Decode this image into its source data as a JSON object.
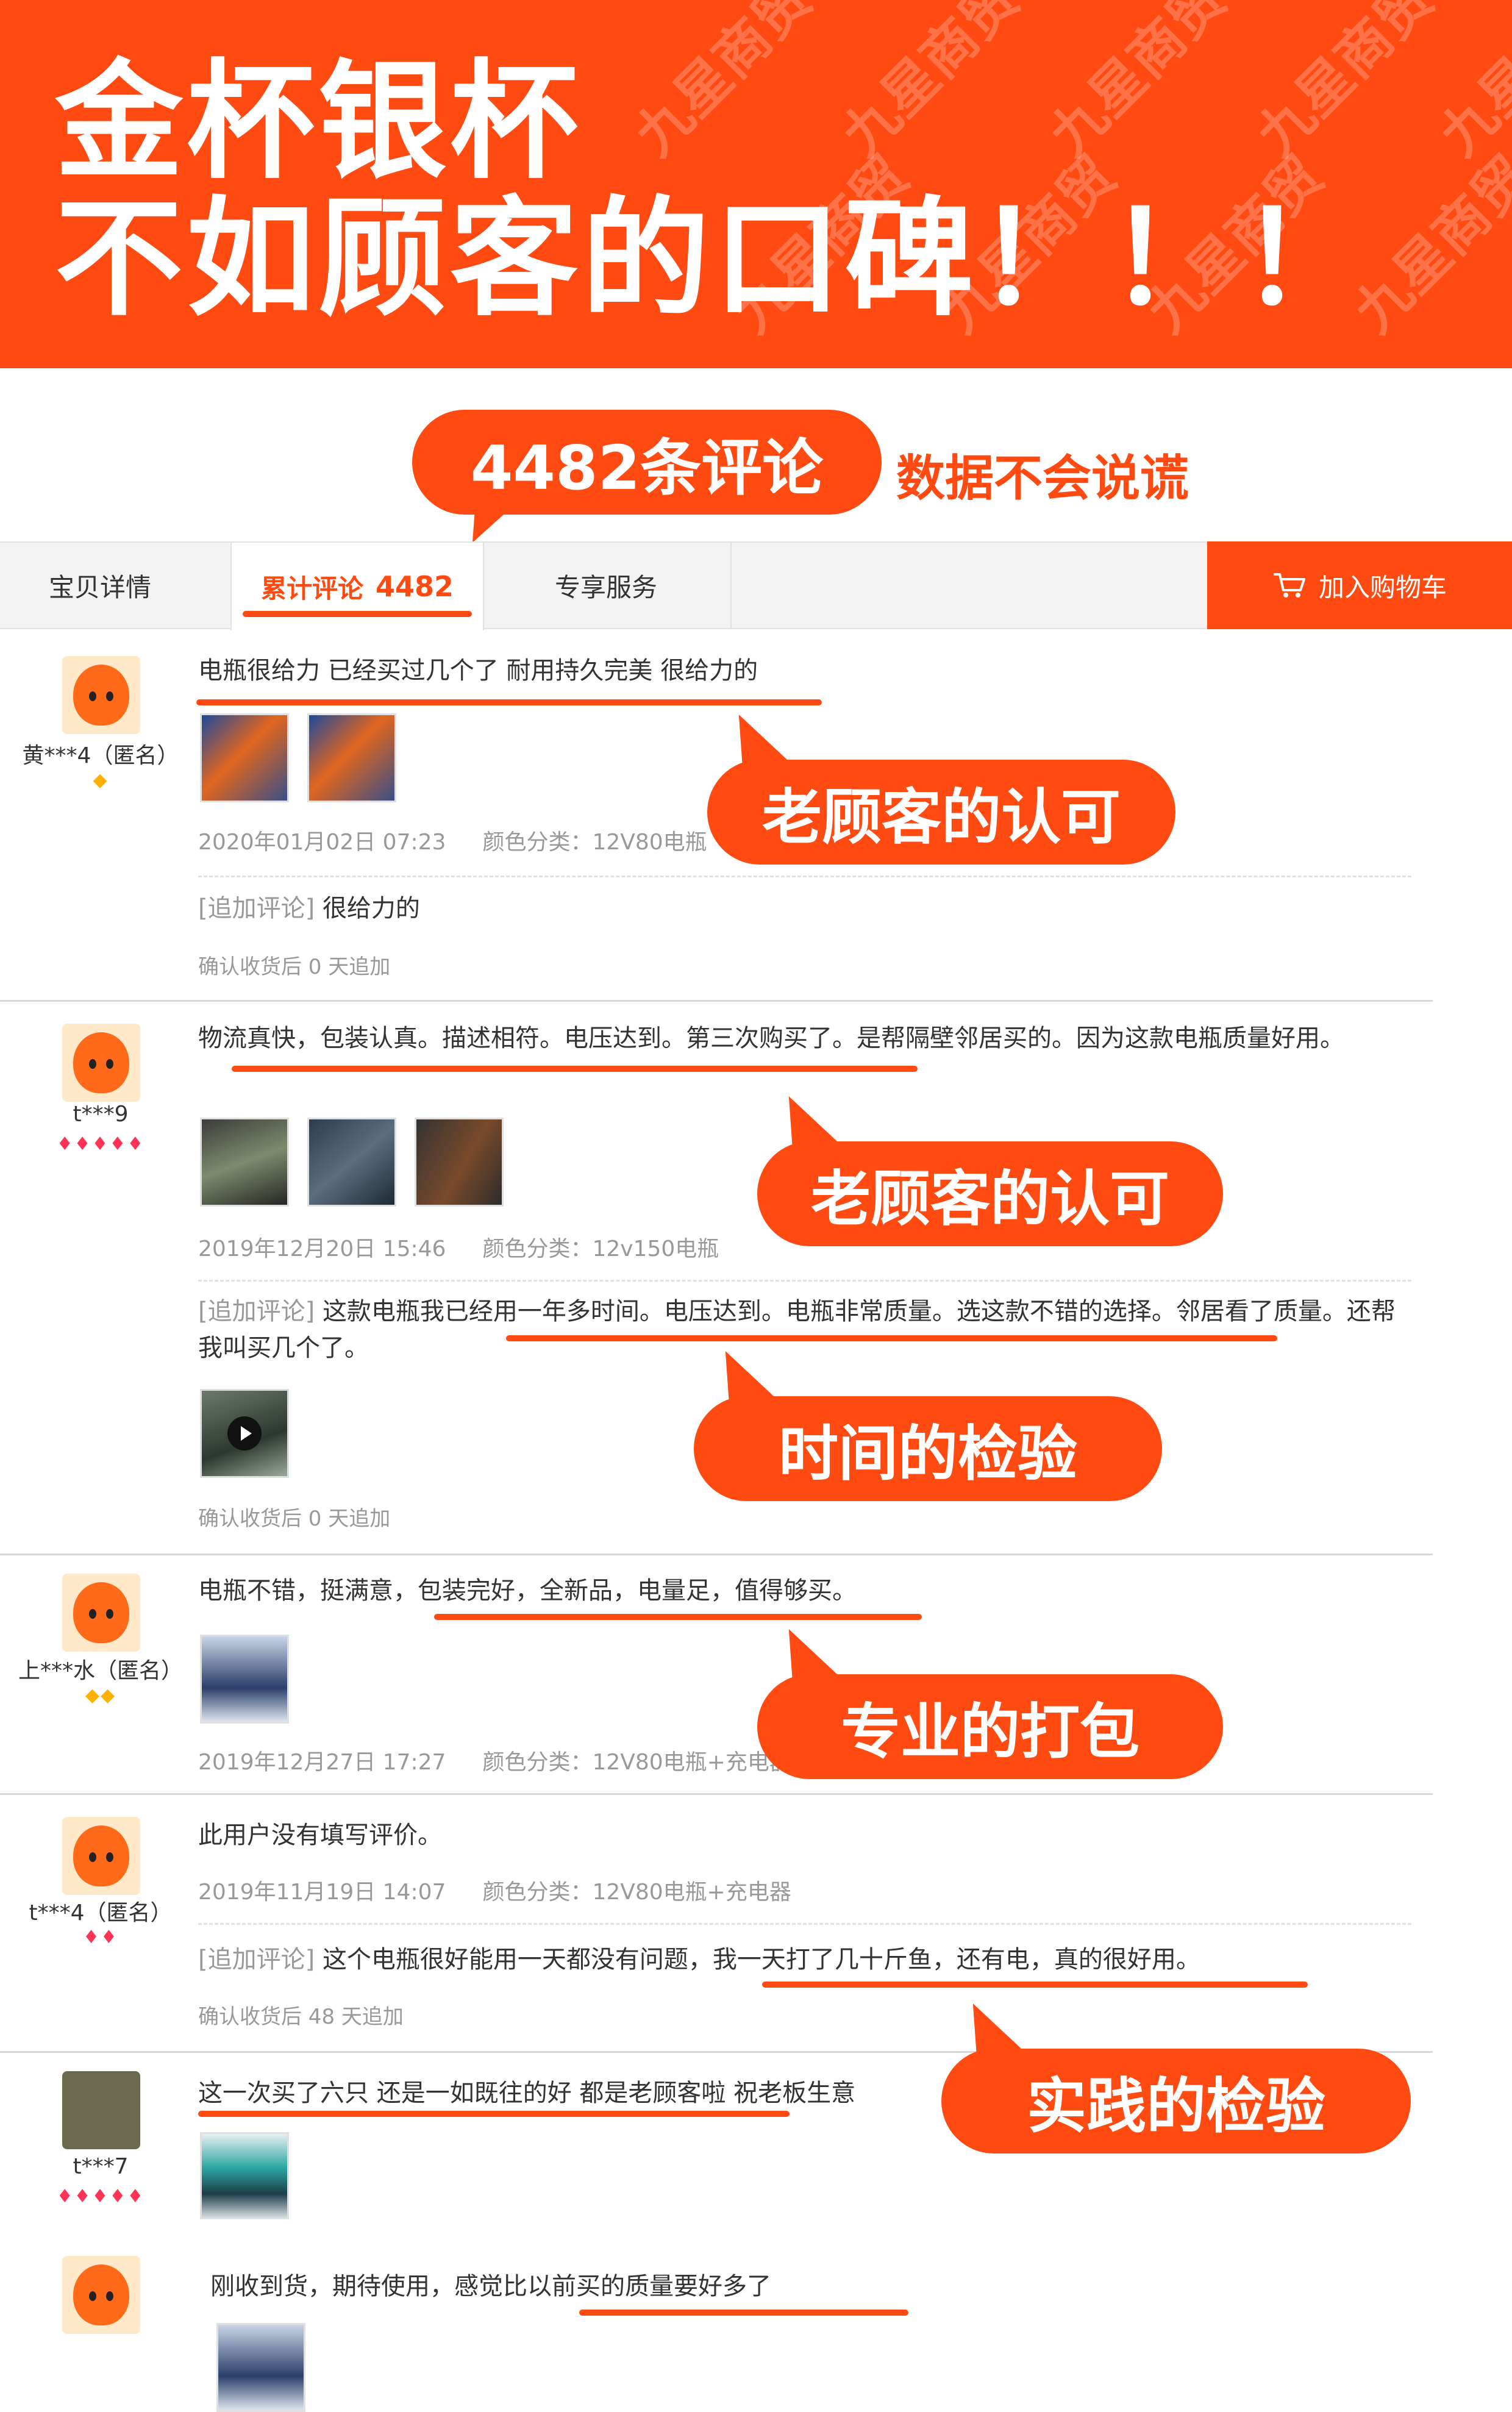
{
  "banner": {
    "line1": "金杯银杯",
    "line2": "不如顾客的口碑！！！",
    "watermark": "九星商贸"
  },
  "headline": {
    "count_label": "4482条评论",
    "tagline": "数据不会说谎"
  },
  "tabs": [
    {
      "label": "宝贝详情"
    },
    {
      "label": "累计评论",
      "count": "4482"
    },
    {
      "label": "专享服务"
    }
  ],
  "cart": {
    "label": "加入购物车",
    "icon": "cart-icon"
  },
  "reviews": [
    {
      "user": "黄***4（匿名）",
      "rank": "◆",
      "text": "电瓶很给力 已经买过几个了 耐用持久完美 很给力的",
      "date": "2020年01月02日 07:23",
      "variant": "颜色分类：12V80电瓶",
      "append": {
        "tag": "[追加评论]",
        "text": "很给力的"
      },
      "after": "确认收货后 0 天追加",
      "callout": "老顾客的认可"
    },
    {
      "user": "t***9",
      "rank": "♦♦♦♦♦",
      "text": "物流真快，包装认真。描述相符。电压达到。第三次购买了。是帮隔壁邻居买的。因为这款电瓶质量好用。",
      "date": "2019年12月20日 15:46",
      "variant": "颜色分类：12v150电瓶",
      "append": {
        "tag": "[追加评论]",
        "text": "这款电瓶我已经用一年多时间。电压达到。电瓶非常质量。选这款不错的选择。邻居看了质量。还帮我叫买几个了。"
      },
      "after": "确认收货后 0 天追加",
      "callout": "老顾客的认可",
      "callout2": "时间的检验"
    },
    {
      "user": "上***水（匿名）",
      "rank": "◆◆",
      "text": "电瓶不错，挺满意，包装完好，全新品，电量足，值得够买。",
      "date": "2019年12月27日 17:27",
      "variant": "颜色分类：12V80电瓶+充电器",
      "callout": "专业的打包"
    },
    {
      "user": "t***4（匿名）",
      "rank": "♦♦",
      "text": "此用户没有填写评价。",
      "date": "2019年11月19日 14:07",
      "variant": "颜色分类：12V80电瓶+充电器",
      "append": {
        "tag": "[追加评论]",
        "text": "这个电瓶很好能用一天都没有问题，我一天打了几十斤鱼，还有电，真的很好用。"
      },
      "after": "确认收货后 48 天追加",
      "callout": "实践的检验"
    },
    {
      "user": "t***7",
      "rank": "♦♦♦♦♦",
      "text": "这一次买了六只 还是一如既往的好 都是老顾客啦 祝老板生意"
    },
    {
      "text": "刚收到货，期待使用，感觉比以前买的质量要好多了"
    }
  ]
}
